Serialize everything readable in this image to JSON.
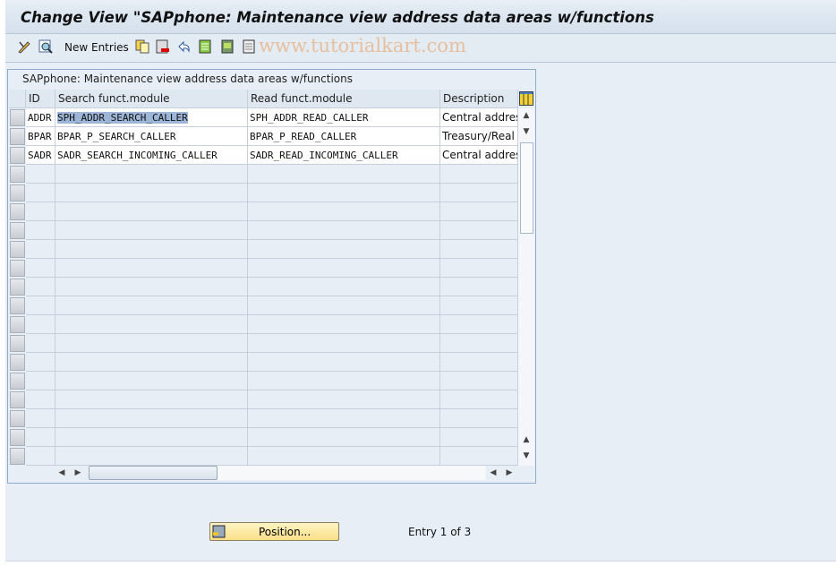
{
  "window": {
    "title": "Change View \"SAPphone: Maintenance view address data areas w/functions"
  },
  "toolbar": {
    "new_entries": "New Entries",
    "watermark": "www.tutorialkart.com",
    "icons": [
      "display-change-icon",
      "details-icon",
      "copy-icon",
      "delete-icon",
      "undo-icon",
      "select-all-icon",
      "select-block-icon",
      "deselect-all-icon"
    ]
  },
  "table": {
    "title": "SAPphone: Maintenance view address data areas w/functions",
    "columns": [
      "ID",
      "Search funct.module",
      "Read funct.module",
      "Description"
    ],
    "rows": [
      {
        "id": "ADDR",
        "search": "SPH_ADDR_SEARCH_CALLER",
        "read": "SPH_ADDR_READ_CALLER",
        "desc": "Central address"
      },
      {
        "id": "BPAR",
        "search": "BPAR_P_SEARCH_CALLER",
        "read": "BPAR_P_READ_CALLER",
        "desc": "Treasury/Real E"
      },
      {
        "id": "SADR",
        "search": "SADR_SEARCH_INCOMING_CALLER",
        "read": "SADR_READ_INCOMING_CALLER",
        "desc": "Central address"
      }
    ]
  },
  "footer": {
    "position_button": "Position...",
    "entry_text": "Entry 1 of 3"
  },
  "colors": {
    "highlight": "#9db5d6",
    "button": "#f9df86",
    "panel_border": "#8eaacc"
  }
}
